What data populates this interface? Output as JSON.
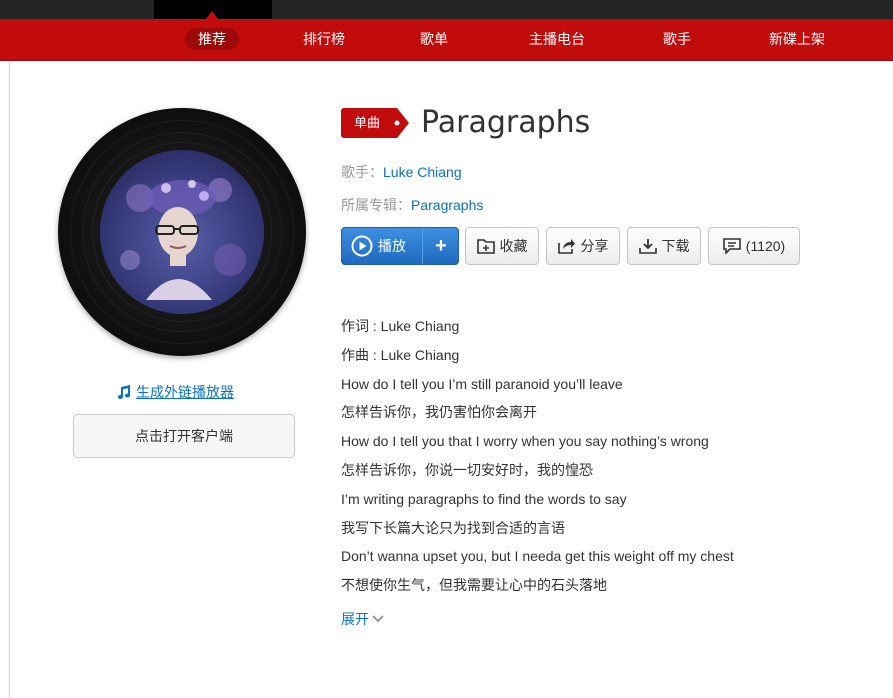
{
  "subnav": {
    "items": [
      "推荐",
      "排行榜",
      "歌单",
      "主播电台",
      "歌手",
      "新碟上架"
    ]
  },
  "sidebar": {
    "gen_link": "生成外链播放器",
    "open_client": "点击打开客户端"
  },
  "song": {
    "tag": "单曲",
    "title": "Paragraphs",
    "artist_label": "歌手：",
    "artist": "Luke Chiang",
    "album_label": "所属专辑：",
    "album": "Paragraphs"
  },
  "actions": {
    "play": "播放",
    "add": "+",
    "collect": "收藏",
    "share": "分享",
    "download": "下载",
    "comments": "(1120)"
  },
  "lyrics": [
    "作词 : Luke Chiang",
    "作曲 : Luke Chiang",
    "How do I tell you I’m still paranoid you’ll leave",
    "怎样告诉你，我仍害怕你会离开",
    "How do I tell you that I worry when you say nothing’s wrong",
    "怎样告诉你，你说一切安好时，我的惶恐",
    "I’m writing paragraphs to find the words to say",
    "我写下长篇大论只为找到合适的言语",
    "Don’t wanna upset you, but I needa get this weight off my chest",
    "不想使你生气，但我需要让心中的石头落地"
  ],
  "expand": "展开",
  "colors": {
    "brand_red": "#c20c0c",
    "link_blue": "#0c73c2",
    "topbar": "#242424"
  },
  "icons": [
    "music-note-icon",
    "play-circle-icon",
    "collect-folder-icon",
    "share-icon",
    "download-icon",
    "comment-icon",
    "chevron-down-icon"
  ]
}
